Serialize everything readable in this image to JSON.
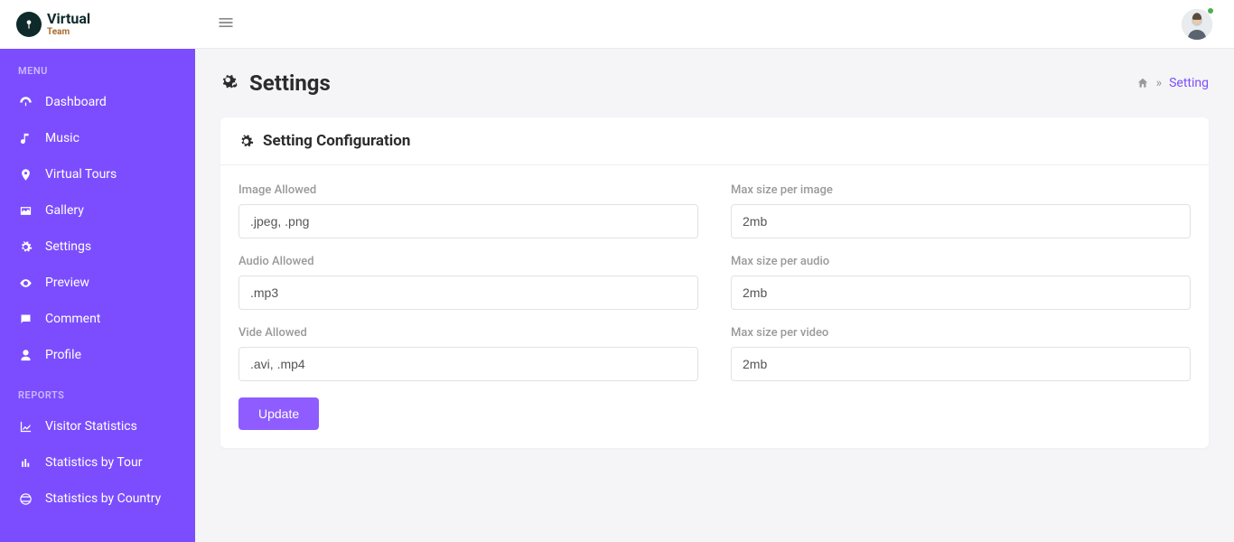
{
  "logo": {
    "name": "Virtual",
    "sub": "Team"
  },
  "sidebar": {
    "sections": [
      {
        "title": "MENU",
        "items": [
          {
            "label": "Dashboard",
            "icon": "dashboard"
          },
          {
            "label": "Music",
            "icon": "music"
          },
          {
            "label": "Virtual Tours",
            "icon": "map-marker"
          },
          {
            "label": "Gallery",
            "icon": "image"
          },
          {
            "label": "Settings",
            "icon": "cogs"
          },
          {
            "label": "Preview",
            "icon": "eye"
          },
          {
            "label": "Comment",
            "icon": "comments"
          },
          {
            "label": "Profile",
            "icon": "user"
          }
        ]
      },
      {
        "title": "REPORTS",
        "items": [
          {
            "label": "Visitor Statistics",
            "icon": "chart-line"
          },
          {
            "label": "Statistics by Tour",
            "icon": "chart-bar"
          },
          {
            "label": "Statistics by Country",
            "icon": "globe"
          }
        ]
      }
    ]
  },
  "page": {
    "title": "Settings",
    "breadcrumb_current": "Setting",
    "breadcrumb_sep": "»"
  },
  "card": {
    "title": "Setting Configuration"
  },
  "form": {
    "fields": {
      "image_allowed": {
        "label": "Image Allowed",
        "value": ".jpeg, .png"
      },
      "max_image": {
        "label": "Max size per image",
        "value": "2mb"
      },
      "audio_allowed": {
        "label": "Audio Allowed",
        "value": ".mp3"
      },
      "max_audio": {
        "label": "Max size per audio",
        "value": "2mb"
      },
      "video_allowed": {
        "label": "Vide Allowed",
        "value": ".avi, .mp4"
      },
      "max_video": {
        "label": "Max size per video",
        "value": "2mb"
      }
    },
    "submit_label": "Update"
  }
}
